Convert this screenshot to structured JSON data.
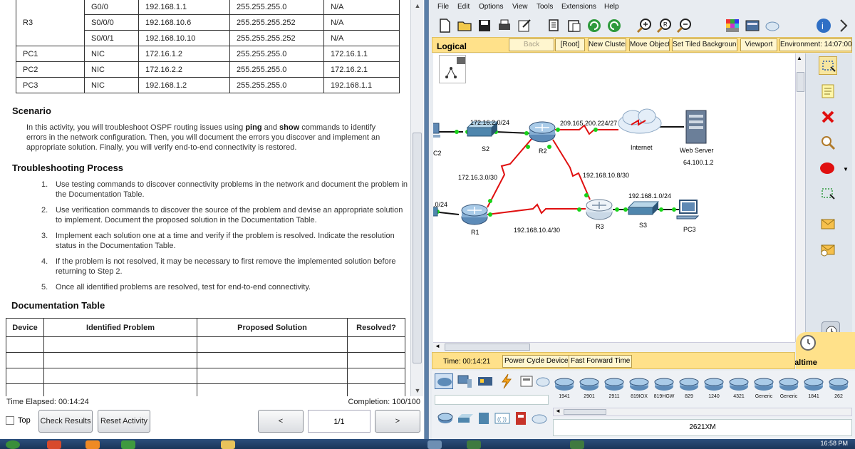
{
  "addressing_table": {
    "rows": [
      {
        "device": "",
        "interface": "G0/0",
        "ip": "192.168.1.1",
        "mask": "255.255.255.0",
        "gateway": "N/A"
      },
      {
        "device": "R3",
        "interface": "S0/0/0",
        "ip": "192.168.10.6",
        "mask": "255.255.255.252",
        "gateway": "N/A"
      },
      {
        "device": "",
        "interface": "S0/0/1",
        "ip": "192.168.10.10",
        "mask": "255.255.255.252",
        "gateway": "N/A"
      },
      {
        "device": "PC1",
        "interface": "NIC",
        "ip": "172.16.1.2",
        "mask": "255.255.255.0",
        "gateway": "172.16.1.1"
      },
      {
        "device": "PC2",
        "interface": "NIC",
        "ip": "172.16.2.2",
        "mask": "255.255.255.0",
        "gateway": "172.16.2.1"
      },
      {
        "device": "PC3",
        "interface": "NIC",
        "ip": "192.168.1.2",
        "mask": "255.255.255.0",
        "gateway": "192.168.1.1"
      }
    ]
  },
  "scenario": {
    "heading": "Scenario",
    "text_1": "In this activity, you will troubleshoot OSPF routing issues using ",
    "bold_ping": "ping",
    "text_2": " and ",
    "bold_show": "show",
    "text_3": " commands to identify errors in the network configuration. Then, you will document the errors you discover and implement an appropriate solution. Finally, you will verify end-to-end connectivity is restored."
  },
  "troubleshooting": {
    "heading": "Troubleshooting Process",
    "steps": [
      {
        "num": "1.",
        "text": "Use testing commands to discover connectivity problems in the network and document the problem in the Documentation Table."
      },
      {
        "num": "2.",
        "text": "Use verification commands to discover the source of the problem and devise an appropriate solution to implement. Document the proposed solution in the Documentation Table."
      },
      {
        "num": "3.",
        "text": "Implement each solution one at a time and verify if the problem is resolved. Indicate the resolution status in the Documentation Table."
      },
      {
        "num": "4.",
        "text": "If the problem is not resolved, it may be necessary to first remove the implemented solution before returning to Step 2."
      },
      {
        "num": "5.",
        "text": "Once all identified problems are resolved, test for end-to-end connectivity."
      }
    ]
  },
  "documentation_table": {
    "heading": "Documentation Table",
    "columns": [
      "Device",
      "Identified Problem",
      "Proposed Solution",
      "Resolved?"
    ]
  },
  "activity_status": {
    "time_elapsed": "Time Elapsed: 00:14:24",
    "completion": "Completion: 100/100",
    "top_label": "Top",
    "check_results": "Check Results",
    "reset_activity": "Reset Activity",
    "prev": "<",
    "page": "1/1",
    "next": ">"
  },
  "pt_menu": [
    "File",
    "Edit",
    "Options",
    "View",
    "Tools",
    "Extensions",
    "Help"
  ],
  "logical_bar": {
    "label": "Logical",
    "back": "Back",
    "root": "[Root]",
    "new_cluster": "New Cluster",
    "move_object": "Move Object",
    "tiled_bg": "Set Tiled Background",
    "viewport": "Viewport",
    "environment": "Environment: 14:07:00"
  },
  "topology": {
    "labels": {
      "lan2": "172.16.2.0/24",
      "wan_r2_internet": "209.165.200.224/27",
      "internet": "Internet",
      "web_server": "Web Server",
      "web_ip": "64.100.1.2",
      "s2": "S2",
      "r2": "R2",
      "pc2": "C2",
      "link_r1_r2": "172.16.3.0/30",
      "link_r2_r3": "192.168.10.8/30",
      "lan3": "192.168.1.0/24",
      "lan1": ".0/24",
      "r1": "R1",
      "r3": "R3",
      "s3": "S3",
      "pc3": "PC3",
      "link_r1_r3": "192.168.10.4/30"
    }
  },
  "timebar": {
    "time": "Time: 00:14:21",
    "power_cycle": "Power Cycle Devices",
    "fast_forward": "Fast Forward Time",
    "mode": "Realtime"
  },
  "device_models": [
    "1941",
    "2901",
    "2911",
    "819IOX",
    "819HGW",
    "829",
    "1240",
    "4321",
    "Generic",
    "Generic",
    "1841",
    "262"
  ],
  "selected_model": "2621XM",
  "tray_time": "16:58 PM",
  "colors": {
    "accent_yellow": "#ffe18a",
    "link_red": "#e01010",
    "port_green": "#19d219"
  }
}
